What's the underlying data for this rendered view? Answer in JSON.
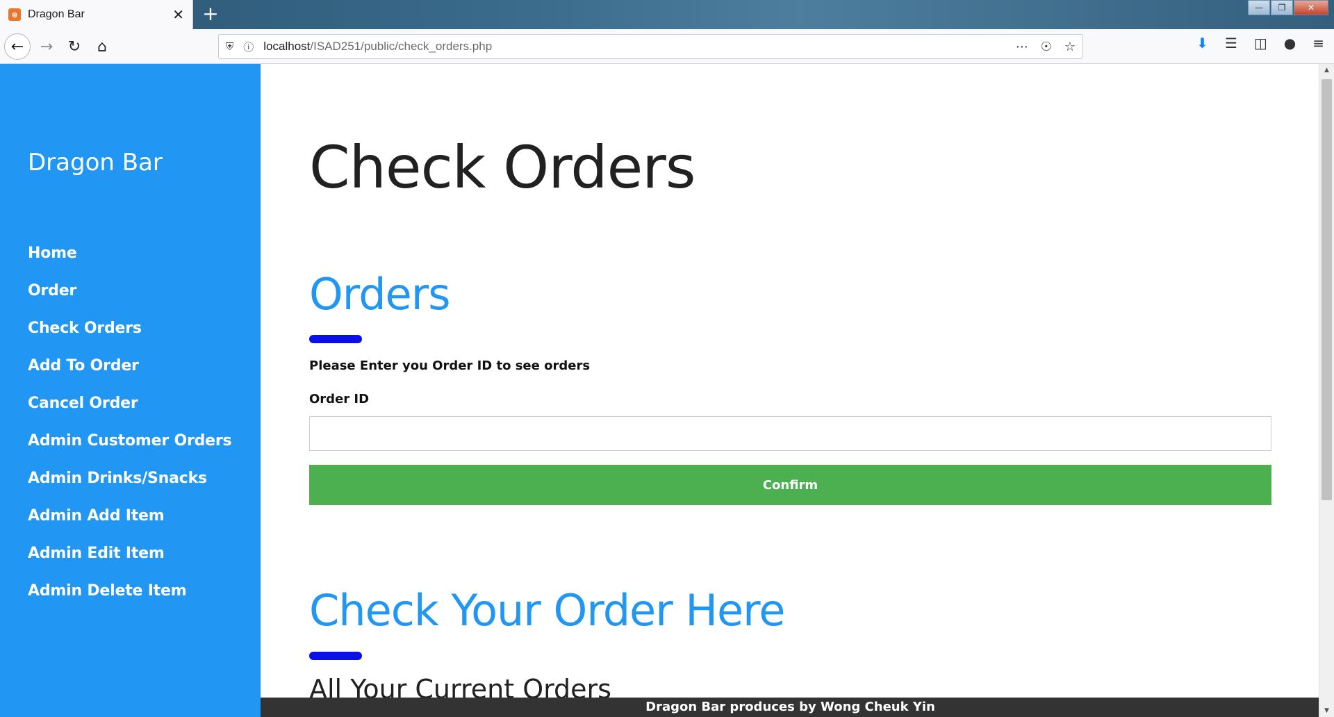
{
  "browser": {
    "tab_title": "Dragon Bar",
    "tab_favicon": "xampp-favicon",
    "new_tab_label": "+",
    "url_host": "localhost",
    "url_path": "/ISAD251/public/check_orders.php"
  },
  "sidebar": {
    "brand": "Dragon Bar",
    "items": [
      {
        "label": "Home"
      },
      {
        "label": "Order"
      },
      {
        "label": "Check Orders"
      },
      {
        "label": "Add To Order"
      },
      {
        "label": "Cancel Order"
      },
      {
        "label": "Admin Customer Orders"
      },
      {
        "label": "Admin Drinks/Snacks"
      },
      {
        "label": "Admin Add Item"
      },
      {
        "label": "Admin Edit Item"
      },
      {
        "label": "Admin Delete Item"
      }
    ]
  },
  "main": {
    "page_title": "Check Orders",
    "orders_section": {
      "title": "Orders",
      "instructions": "Please Enter you Order ID to see orders",
      "field_label": "Order ID",
      "field_value": "",
      "confirm_label": "Confirm"
    },
    "check_section": {
      "title": "Check Your Order Here",
      "subheading": "All Your Current Orders"
    }
  },
  "footer": {
    "text": "Dragon Bar produces by Wong Cheuk Yin"
  },
  "colors": {
    "sidebar": "#2196f3",
    "accent_heading": "#2196f3",
    "underline_bar": "#0a10e6",
    "confirm_button": "#4caf50",
    "footer": "#333333"
  }
}
